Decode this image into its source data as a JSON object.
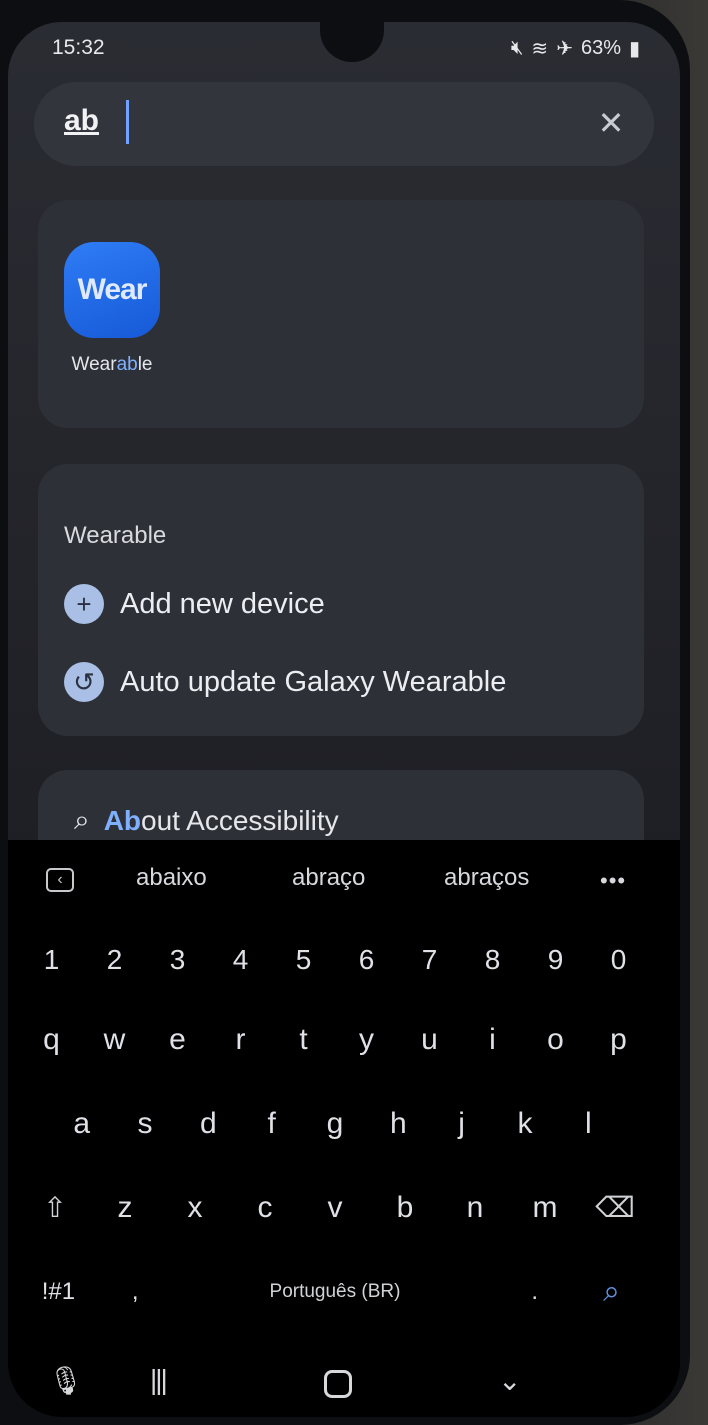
{
  "status_bar": {
    "time": "15:32",
    "icons": [
      "mute-icon",
      "wifi-icon",
      "airplane-icon"
    ],
    "battery": "63%"
  },
  "search": {
    "query": "ab",
    "clear_icon": "close-icon"
  },
  "app_result": {
    "icon_text": "Wear",
    "label_prefix": "Wear",
    "label_match": "ab",
    "label_suffix": "le"
  },
  "settings": {
    "heading": "Wearable",
    "items": [
      {
        "icon": "plus-icon",
        "label": "Add new device"
      },
      {
        "icon": "refresh-icon",
        "label": "Auto update Galaxy Wearable"
      }
    ]
  },
  "accessibility_result": {
    "icon": "search-icon",
    "match": "Ab",
    "rest": "out Accessibility"
  },
  "keyboard": {
    "suggestions": [
      "abaixo",
      "abraço",
      "abraços"
    ],
    "number_row": [
      "1",
      "2",
      "3",
      "4",
      "5",
      "6",
      "7",
      "8",
      "9",
      "0"
    ],
    "row_q": [
      "q",
      "w",
      "e",
      "r",
      "t",
      "y",
      "u",
      "i",
      "o",
      "p"
    ],
    "row_a": [
      "a",
      "s",
      "d",
      "f",
      "g",
      "h",
      "j",
      "k",
      "l"
    ],
    "row_z": [
      "z",
      "x",
      "c",
      "v",
      "b",
      "n",
      "m"
    ],
    "symbols_key": "!#1",
    "comma_key": ",",
    "space_label": "Português (BR)",
    "period_key": "."
  },
  "nav_bar": {
    "items": [
      "microphone-icon",
      "recent-apps-icon",
      "home-icon",
      "hide-keyboard-icon"
    ]
  },
  "colors": {
    "accent": "#7fb0ff",
    "app_icon": "#2f7df6",
    "background": "#25262c",
    "keyboard": "#000000"
  }
}
